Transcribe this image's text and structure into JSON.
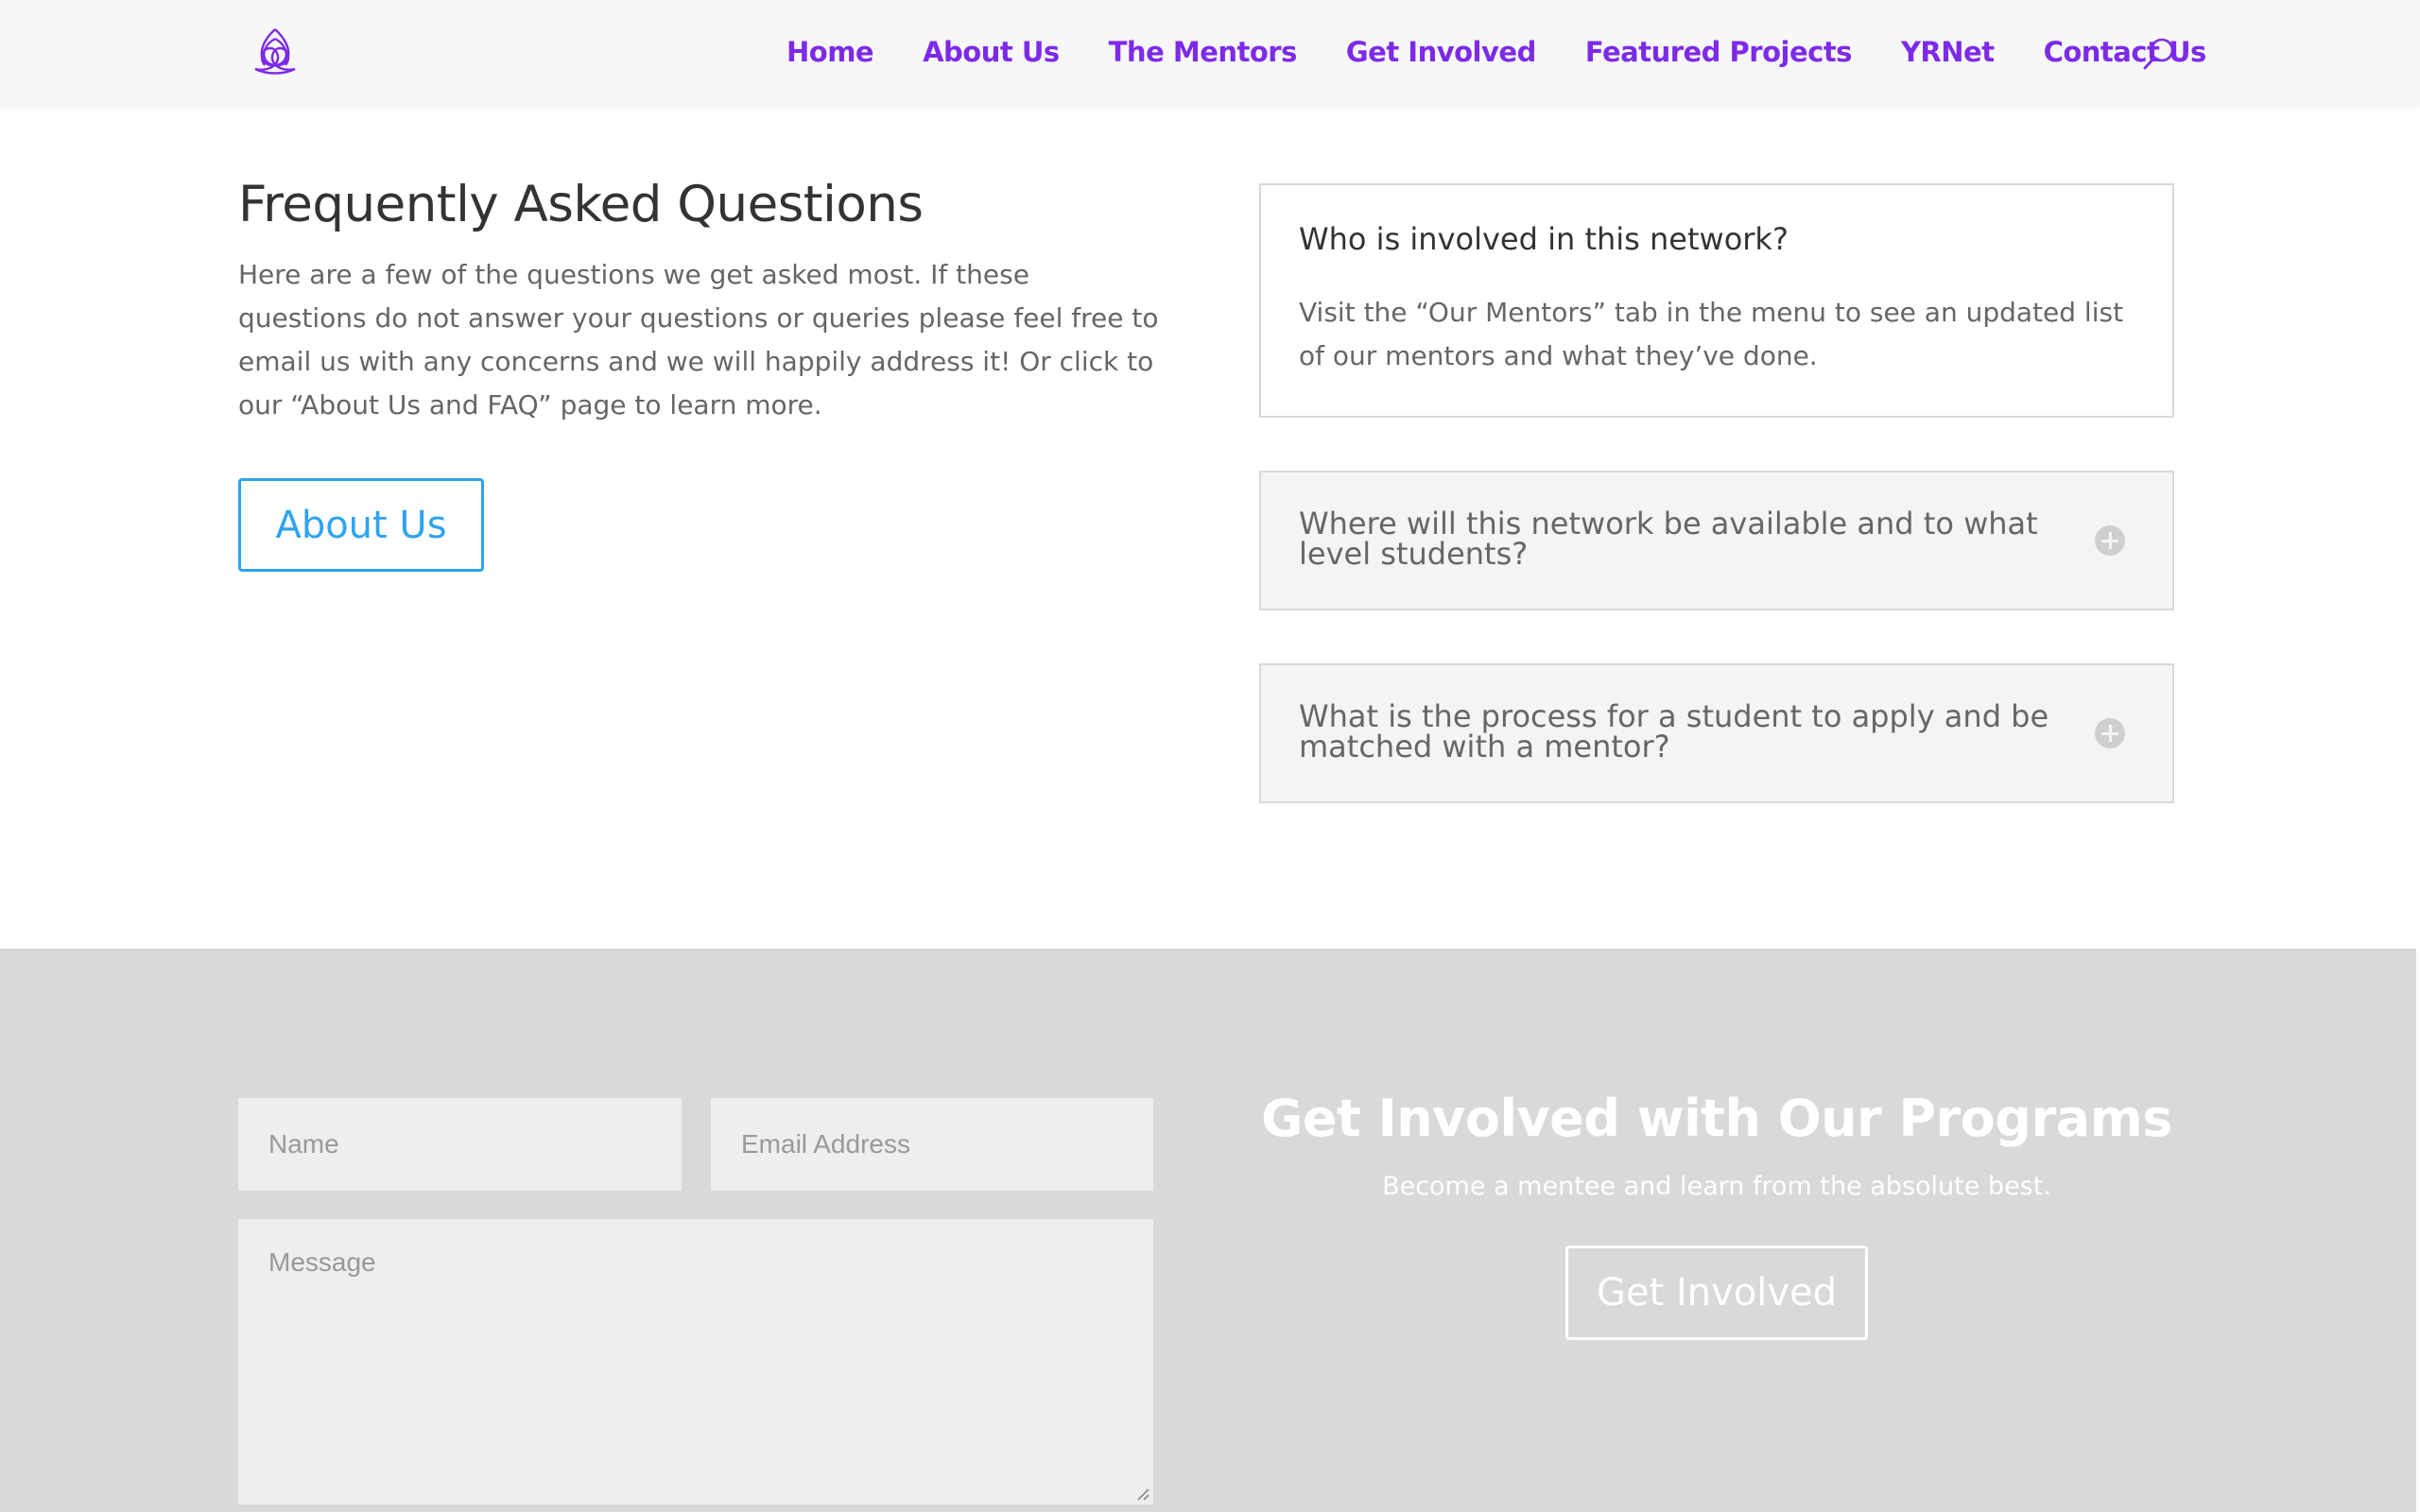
{
  "colors": {
    "nav_link": "#7d2ae8",
    "button_accent": "#2ea3f2",
    "footer_background": "#d9d9d9"
  },
  "header": {
    "logo_icon": "triquetra-knot-logo",
    "nav": [
      "Home",
      "About Us",
      "The Mentors",
      "Get Involved",
      "Featured Projects",
      "YRNet",
      "Contact Us"
    ],
    "search_icon": "search-icon"
  },
  "faq": {
    "title": "Frequently Asked Questions",
    "intro": "Here are a few of the questions we get asked most. If these questions do not answer your questions or queries please feel free to email us with any concerns and we will happily address it! Or click to our “About Us and FAQ” page to learn more.",
    "about_button": "About Us",
    "toggles": [
      {
        "question": "Who is involved in this network?",
        "answer": "Visit the “Our Mentors” tab in the menu to see an updated list of our mentors and what they’ve done.",
        "open": true
      },
      {
        "question": "Where will this network be available and to what level students?",
        "open": false
      },
      {
        "question": "What is the process for a student to apply and be matched with a mentor?",
        "open": false
      }
    ]
  },
  "contact": {
    "name_placeholder": "Name",
    "email_placeholder": "Email Address",
    "message_placeholder": "Message",
    "cta_title": "Get Involved with Our Programs",
    "cta_subtitle": "Become a mentee and learn from the absolute best.",
    "cta_button": "Get Involved"
  }
}
